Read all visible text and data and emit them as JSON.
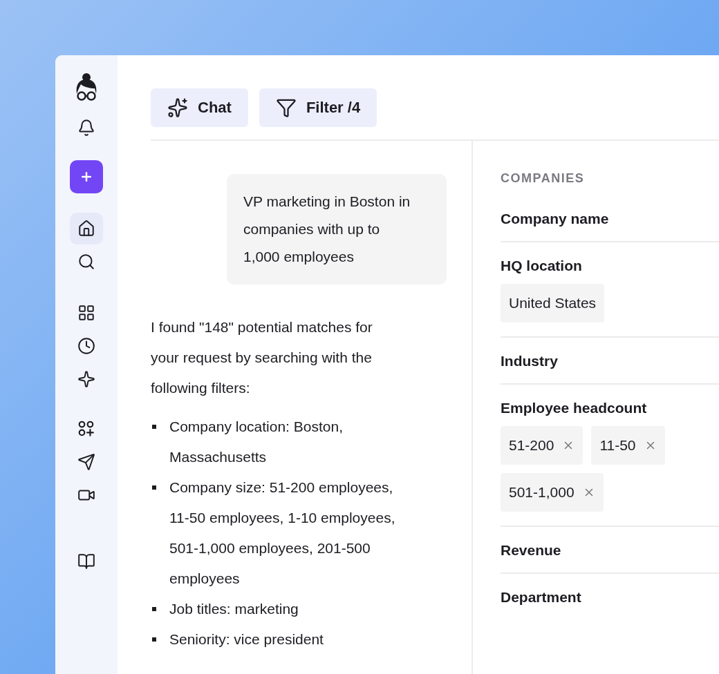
{
  "nav_items": [
    {
      "selected": false
    },
    {
      "selected": true
    },
    {
      "selected": false
    },
    {
      "selected": false
    },
    {
      "selected": false
    },
    {
      "selected": false
    },
    {
      "selected": false
    },
    {
      "selected": false
    },
    {
      "selected": false
    },
    {
      "selected": false
    }
  ],
  "toolbar": [
    {
      "kind": "chat",
      "label": "Chat"
    },
    {
      "kind": "filter",
      "label": "Filter /4"
    }
  ],
  "chat": {
    "user_message": "VP marketing in Boston in companies with up to 1,000 employees",
    "reply": "I found \"148\" potential matches for your request by searching with the following filters:",
    "bullets": [
      "Company location: Boston, Massachusetts",
      "Company size: 51-200 employees, 11-50 employees, 1-10 employees, 501-1,000 employees, 201-500 employees",
      "Job titles: marketing",
      "Seniority: vice president"
    ]
  },
  "filters": {
    "heading": "COMPANIES",
    "sections": [
      {
        "label": "Company name"
      },
      {
        "label": "HQ location",
        "chips": [
          {
            "text": "United States",
            "removable": false
          }
        ]
      },
      {
        "label": "Industry"
      },
      {
        "label": "Employee headcount",
        "chips": [
          {
            "text": "51-200",
            "removable": true
          },
          {
            "text": "11-50",
            "removable": true
          },
          {
            "text": "501-1,000",
            "removable": true
          }
        ]
      },
      {
        "label": "Revenue"
      },
      {
        "label": "Department"
      }
    ]
  }
}
